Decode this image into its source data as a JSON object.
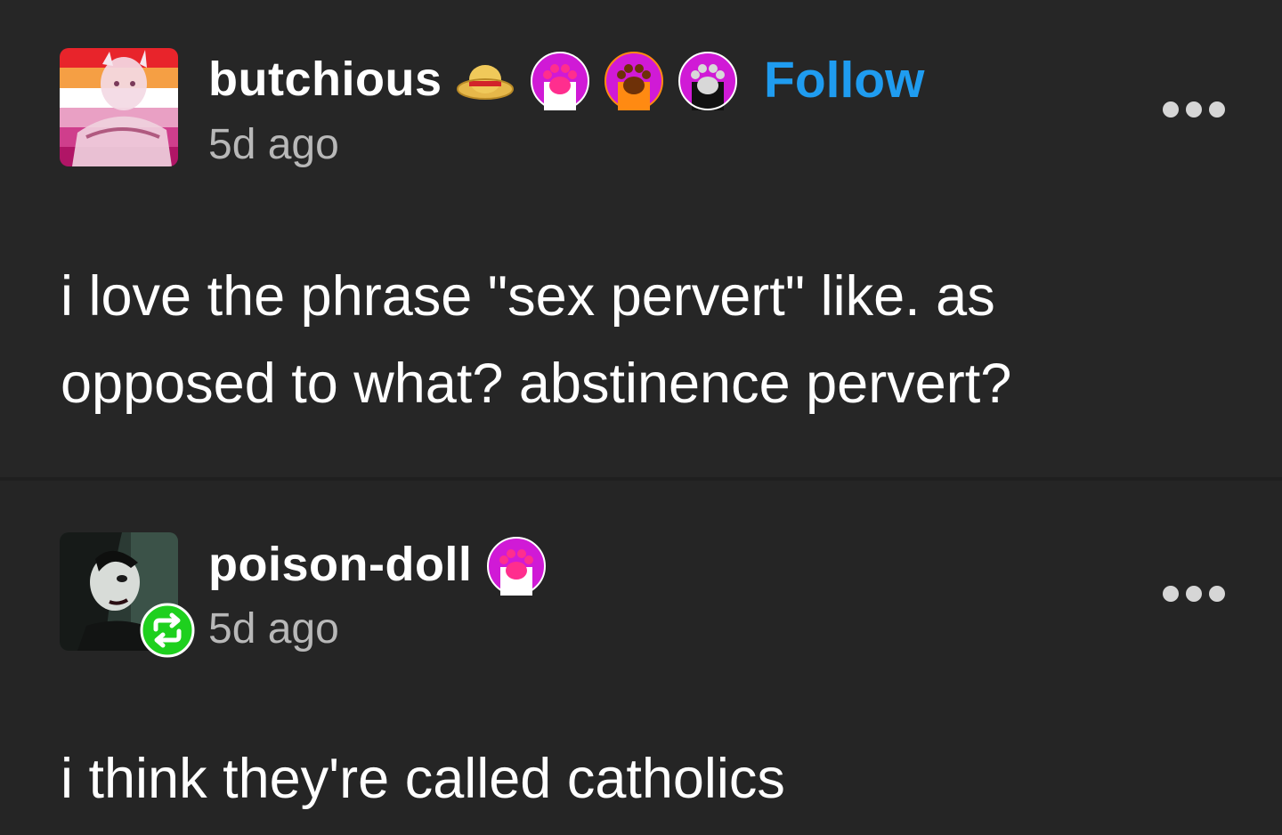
{
  "posts": [
    {
      "username": "butchious",
      "timestamp": "5d ago",
      "follow_label": "Follow",
      "badges": [
        "straw-hat-icon",
        "pink-paw-badge",
        "orange-paw-badge",
        "black-paw-badge"
      ],
      "body": "i love the phrase \"sex pervert\" like. as opposed to what? abstinence pervert?"
    },
    {
      "username": "poison-doll",
      "timestamp": "5d ago",
      "badges": [
        "pink-paw-badge"
      ],
      "reblog_icon": "reblog-icon",
      "body": "i think they're called catholics"
    }
  ],
  "colors": {
    "background": "#262626",
    "follow": "#1f9cf0",
    "timestamp": "#b8b8b8",
    "reblog_badge": "#1ed01e"
  }
}
